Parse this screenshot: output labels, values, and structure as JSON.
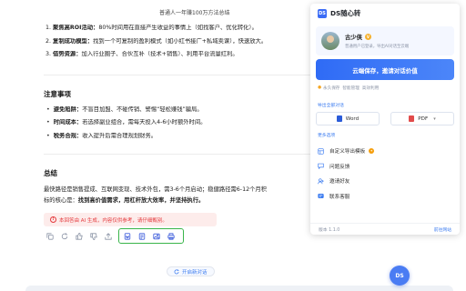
{
  "chat": {
    "doc_title": "普通人一年赚100万方法总结",
    "ordered": [
      {
        "num": "1.",
        "title": "聚焦高ROI活动：",
        "text": "80%时间用在直接产生收益的事情上（如找客户、优化转化）。"
      },
      {
        "num": "2.",
        "title": "复制成功模型：",
        "text": "找到一个可复制的盈利模式（如小红书接广+私域卖课），快速放大。"
      },
      {
        "num": "3.",
        "title": "借势资源：",
        "text": "加入行业圈子、合伙互补（技术+销售）、利用平台流量红利。"
      }
    ],
    "notes_heading": "注意事项",
    "notes": [
      {
        "title": "避免陷阱：",
        "text": "不盲目加盟、不碰传销、警惕“轻松赚钱”骗局。"
      },
      {
        "title": "时间成本：",
        "text": "若选择副业组合，需每天投入4-6小时额外时间。"
      },
      {
        "title": "税务合规：",
        "text": "收入提升后需合理规划财务。"
      }
    ],
    "summary_heading": "总结",
    "summary_line1": "最快路径是销售提成、互联网变现、技术外包，需3-6个月启动；稳健路径需6-12个月积",
    "summary_line2_prefix": "标的核心是：",
    "summary_line2_bold": "找到高价值需求，用杠杆放大效率，并坚持执行。",
    "warning": "本回答由 AI 生成，内容仅供参考，请仔细甄别。",
    "new_chat": "开启新对话",
    "fab_label": "DS"
  },
  "panel": {
    "logo": "DS",
    "title": "DS随心转",
    "user": {
      "name": "古少侠",
      "badge": "V",
      "desc": "普通用户已登录，导出AI对话至云端"
    },
    "cta": "云端保存，邀请对话价值",
    "tags": [
      "永久保存",
      "智能管理",
      "高效利用"
    ],
    "export_label": "导出全部对话",
    "exports": [
      {
        "label": "Word",
        "color": "#2b5cd9"
      },
      {
        "label": "PDF",
        "color": "#e14b4b"
      }
    ],
    "more_label": "更多选项",
    "menu": [
      {
        "label": "自定义导出模板",
        "icon": "template-icon",
        "hot": true
      },
      {
        "label": "问题反馈",
        "icon": "feedback-icon",
        "hot": false
      },
      {
        "label": "邀请好友",
        "icon": "invite-icon",
        "hot": false
      },
      {
        "label": "联系客服",
        "icon": "support-icon",
        "hot": false
      }
    ],
    "version": "版本 1.1.0",
    "site": "前往网站"
  },
  "colors": {
    "accent": "#3b6cf6",
    "warning": "#e4393c",
    "highlight": "#39b54a"
  }
}
